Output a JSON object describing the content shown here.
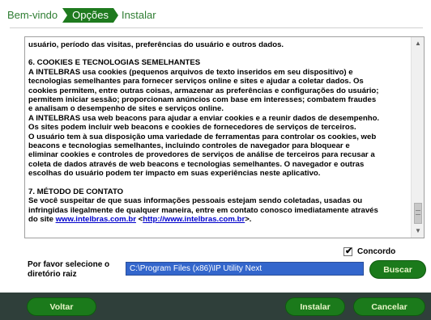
{
  "steps": {
    "welcome": "Bem-vindo",
    "options": "Opções",
    "install": "Instalar"
  },
  "license": {
    "lines_p1": [
      "usuário, período das visitas, preferências do usuário e outros dados."
    ],
    "section6_title": "6. COOKIES E TECNOLOGIAS SEMELHANTES",
    "section6_lines": [
      "A INTELBRAS usa cookies (pequenos arquivos de texto inseridos em seu dispositivo) e",
      "tecnologias semelhantes para fornecer serviços online e sites e ajudar a coletar dados. Os",
      "cookies permitem, entre outras coisas, armazenar as preferências e configurações do usuário;",
      "permitem iniciar sessão; proporcionam anúncios com base em interesses; combatem fraudes",
      "e analisam o desempenho de sites e serviços online.",
      "A INTELBRAS usa web beacons para ajudar a enviar cookies e a reunir dados de desempenho.",
      "Os sites podem incluir web beacons e cookies de fornecedores de serviços de terceiros.",
      "O usuário tem à sua disposição uma variedade de ferramentas para controlar os cookies, web",
      "beacons e tecnologias semelhantes, incluindo controles de navegador para bloquear e",
      "eliminar cookies e controles de provedores de serviços de análise de terceiros para recusar a",
      "coleta de dados através de web beacons e tecnologias semelhantes. O navegador e outras",
      "escolhas do usuário podem ter impacto em suas experiências neste aplicativo."
    ],
    "section7_title": "7. MÉTODO DE CONTATO",
    "section7_lines": [
      "Se você suspeitar de que suas informações pessoais estejam sendo coletadas, usadas ou",
      "infringidas ilegalmente de qualquer maneira, entre em contato conosco imediatamente através"
    ],
    "section7_last_prefix": "do site ",
    "link1": "www.intelbras.com.br",
    "link_sep": " <",
    "link2": "http://www.intelbras.com.br",
    "link_suffix": ">."
  },
  "agree": {
    "label": "Concordo",
    "checked_glyph": "✔"
  },
  "directory": {
    "label": "Por favor selecione o diretório raiz",
    "value": "C:\\Program Files (x86)\\IP Utility Next",
    "browse": "Buscar"
  },
  "footer": {
    "back": "Voltar",
    "install": "Instalar",
    "cancel": "Cancelar"
  },
  "icons": {
    "scroll_up": "▲",
    "scroll_down": "▼"
  },
  "colors": {
    "accent": "#1b7a1b",
    "footer_bg": "#2f3f3a",
    "selection": "#3366cc"
  }
}
